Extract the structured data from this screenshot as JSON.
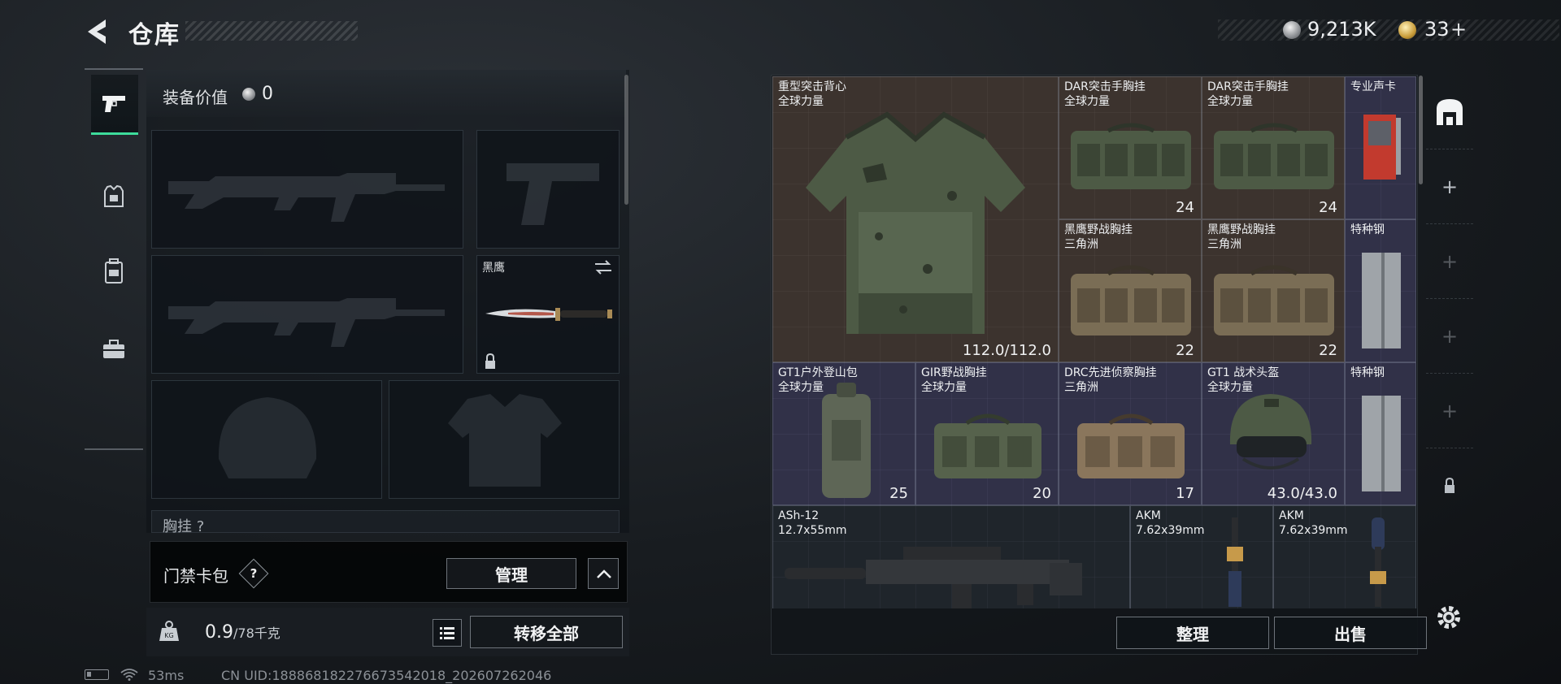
{
  "header": {
    "title": "仓库",
    "currency_silver": "9,213K",
    "currency_gold": "33",
    "currency_gold_plus": "+"
  },
  "loadout": {
    "equip_value_label": "装备价值",
    "equip_value": "0",
    "knife_name": "黑鹰",
    "chest_label": "胸挂 ?"
  },
  "card_bar": {
    "label": "门禁卡包",
    "help": "?",
    "manage_label": "管理"
  },
  "weight": {
    "current": "0.9",
    "max": "/78千克",
    "transfer_label": "转移全部"
  },
  "status_bar": {
    "ping": "53ms",
    "uid": "CN UID:1888681822766735420​18_202607262046"
  },
  "stash": {
    "items": [
      {
        "name": "重型突击背心\n全球力量",
        "stat": "112.0/112.0"
      },
      {
        "name": "DAR突击手胸挂\n全球力量",
        "stat": "24"
      },
      {
        "name": "DAR突击手胸挂\n全球力量",
        "stat": "24"
      },
      {
        "name": "专业声卡",
        "stat": ""
      },
      {
        "name": "黑鹰野战胸挂\n三角洲",
        "stat": "22"
      },
      {
        "name": "黑鹰野战胸挂\n三角洲",
        "stat": "22"
      },
      {
        "name": "特种钢",
        "stat": ""
      },
      {
        "name": "GT1户外登山包\n全球力量",
        "stat": "25"
      },
      {
        "name": "GIR野战胸挂\n全球力量",
        "stat": "20"
      },
      {
        "name": "DRC先进侦察胸挂\n三角洲",
        "stat": "17"
      },
      {
        "name": "GT1 战术头盔\n全球力量",
        "stat": "43.0/43.0"
      },
      {
        "name": "特种钢",
        "stat": ""
      },
      {
        "name": "ASh-12\n12.7x55mm",
        "stat": ""
      },
      {
        "name": "AKM\n7.62x39mm",
        "stat": ""
      },
      {
        "name": "AKM\n7.62x39mm",
        "stat": ""
      }
    ],
    "sort_label": "整理",
    "sell_label": "出售"
  },
  "colors": {
    "accent_green": "#3ddc9b",
    "rarity_brown": "#524034",
    "rarity_purple": "#464066"
  }
}
